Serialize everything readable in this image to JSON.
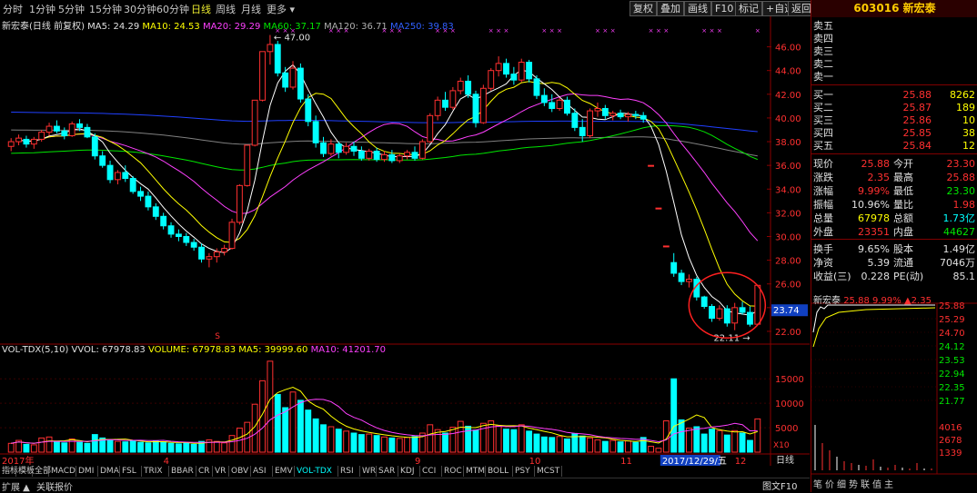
{
  "toolbar": {
    "periods": [
      "分时",
      "1分钟",
      "5分钟",
      "15分钟",
      "30分钟",
      "60分钟",
      "日线",
      "周线",
      "月线",
      "更多 ▾"
    ],
    "active_period": "日线",
    "buttons": [
      "复权",
      "叠加",
      "画线",
      "F10",
      "标记",
      "+自选",
      "返回"
    ]
  },
  "chart_title": {
    "name": "新宏泰(日线 前复权)",
    "ma5": "MA5: 24.29",
    "ma10": "MA10: 24.53",
    "ma20": "MA20: 29.29",
    "ma60": "MA60: 37.17",
    "ma120": "MA120: 36.71",
    "ma250": "MA250: 39.83"
  },
  "vol_title": {
    "name": "VOL-TDX(5,10)",
    "vvol": "VVOL: 67978.83",
    "volume": "VOLUME: 67978.83",
    "ma5": "MA5: 39999.60",
    "ma10": "MA10: 41201.70"
  },
  "annotations": {
    "high": "47.00",
    "low": "22.11",
    "current_tag": "23.74",
    "marker_s": "S",
    "x_unit": "X10"
  },
  "dates": {
    "axis_labels": [
      "2017年",
      "4",
      "9",
      "10",
      "11",
      "12"
    ],
    "cursor_date": "2017/12/29/五"
  },
  "colors": {
    "up": "#ff3030",
    "down": "#00ffff",
    "ma5": "#ffffff",
    "ma10": "#ffff00",
    "ma20": "#ff40ff",
    "ma60": "#00e600",
    "ma120": "#808080",
    "ma250": "#2040ff"
  },
  "chart_data": {
    "type": "candlestick",
    "price_axis": [
      "46.00",
      "44.00",
      "42.00",
      "40.00",
      "38.00",
      "36.00",
      "34.00",
      "32.00",
      "30.00",
      "28.00",
      "26.00",
      "24.00",
      "22.00"
    ],
    "ylim": [
      21,
      47.5
    ],
    "vol_axis": [
      "15000",
      "10000",
      "5000"
    ],
    "vol_ylim": [
      0,
      19500
    ],
    "candles": [
      [
        37.6,
        38.3,
        37.2,
        38.0
      ],
      [
        38.0,
        38.6,
        37.7,
        38.3
      ],
      [
        38.2,
        38.5,
        37.5,
        37.8
      ],
      [
        37.8,
        38.4,
        37.4,
        38.2
      ],
      [
        38.2,
        39.0,
        38.0,
        38.8
      ],
      [
        38.8,
        39.6,
        38.5,
        39.3
      ],
      [
        39.3,
        39.8,
        38.7,
        38.9
      ],
      [
        38.9,
        39.2,
        38.2,
        38.5
      ],
      [
        38.5,
        39.7,
        38.4,
        39.5
      ],
      [
        39.5,
        39.9,
        38.9,
        39.2
      ],
      [
        39.2,
        39.5,
        38.3,
        38.4
      ],
      [
        38.4,
        38.7,
        36.5,
        36.8
      ],
      [
        36.8,
        37.2,
        35.8,
        36.0
      ],
      [
        36.0,
        36.4,
        34.5,
        34.8
      ],
      [
        34.8,
        35.6,
        34.4,
        35.4
      ],
      [
        35.4,
        36.0,
        34.6,
        34.9
      ],
      [
        34.9,
        35.1,
        33.6,
        33.8
      ],
      [
        33.8,
        34.2,
        33.0,
        33.4
      ],
      [
        33.4,
        33.8,
        32.2,
        32.5
      ],
      [
        32.5,
        32.8,
        31.4,
        31.7
      ],
      [
        31.7,
        32.0,
        30.6,
        30.9
      ],
      [
        30.9,
        31.2,
        29.9,
        30.2
      ],
      [
        30.2,
        30.6,
        29.6,
        30.0
      ],
      [
        30.0,
        30.3,
        29.2,
        29.5
      ],
      [
        29.5,
        29.8,
        28.8,
        29.1
      ],
      [
        29.1,
        29.4,
        27.8,
        28.1
      ],
      [
        28.1,
        28.6,
        27.4,
        28.3
      ],
      [
        28.3,
        29.0,
        27.8,
        28.7
      ],
      [
        28.7,
        29.3,
        28.4,
        29.0
      ],
      [
        29.0,
        31.5,
        28.9,
        31.2
      ],
      [
        31.2,
        34.4,
        31.0,
        34.3
      ],
      [
        34.3,
        37.7,
        34.2,
        37.7
      ],
      [
        37.7,
        41.5,
        37.6,
        41.5
      ],
      [
        41.5,
        45.6,
        41.4,
        45.6
      ],
      [
        45.6,
        47.0,
        44.5,
        46.2
      ],
      [
        46.2,
        46.5,
        43.5,
        43.8
      ],
      [
        43.8,
        44.3,
        42.2,
        42.6
      ],
      [
        42.6,
        44.8,
        42.4,
        44.2
      ],
      [
        44.2,
        44.6,
        41.3,
        41.6
      ],
      [
        41.6,
        42.0,
        39.3,
        39.7
      ],
      [
        39.7,
        40.2,
        37.5,
        37.9
      ],
      [
        37.9,
        38.4,
        36.7,
        37.0
      ],
      [
        37.0,
        38.2,
        36.8,
        37.8
      ],
      [
        37.8,
        38.0,
        36.6,
        37.1
      ],
      [
        37.1,
        37.9,
        36.9,
        37.6
      ],
      [
        37.6,
        38.0,
        36.8,
        37.2
      ],
      [
        37.2,
        37.6,
        36.4,
        36.6
      ],
      [
        36.6,
        37.4,
        36.4,
        37.2
      ],
      [
        37.2,
        37.5,
        36.3,
        36.5
      ],
      [
        36.5,
        37.2,
        36.3,
        36.9
      ],
      [
        36.9,
        37.3,
        36.2,
        36.4
      ],
      [
        36.4,
        37.0,
        36.2,
        36.8
      ],
      [
        36.8,
        37.3,
        36.5,
        37.1
      ],
      [
        37.1,
        37.6,
        36.4,
        36.6
      ],
      [
        36.6,
        38.2,
        36.5,
        38.0
      ],
      [
        38.0,
        40.4,
        37.9,
        40.2
      ],
      [
        40.2,
        41.8,
        39.8,
        41.5
      ],
      [
        41.5,
        42.2,
        40.6,
        40.9
      ],
      [
        40.9,
        42.6,
        40.7,
        42.3
      ],
      [
        42.3,
        43.4,
        42.0,
        43.1
      ],
      [
        43.1,
        43.6,
        41.7,
        42.0
      ],
      [
        42.0,
        42.3,
        39.2,
        39.6
      ],
      [
        39.6,
        42.8,
        39.5,
        42.5
      ],
      [
        42.5,
        44.2,
        42.3,
        44.0
      ],
      [
        44.0,
        45.2,
        43.5,
        44.6
      ],
      [
        44.6,
        45.0,
        43.4,
        43.7
      ],
      [
        43.7,
        44.3,
        42.8,
        43.2
      ],
      [
        43.2,
        45.0,
        43.0,
        44.7
      ],
      [
        44.7,
        44.9,
        43.0,
        43.3
      ],
      [
        43.3,
        43.6,
        41.6,
        41.9
      ],
      [
        41.9,
        42.5,
        41.0,
        41.3
      ],
      [
        41.3,
        42.0,
        40.5,
        40.8
      ],
      [
        40.8,
        41.7,
        40.6,
        41.5
      ],
      [
        41.5,
        41.8,
        40.2,
        40.4
      ],
      [
        40.4,
        40.8,
        38.9,
        39.2
      ],
      [
        39.2,
        39.9,
        38.0,
        38.5
      ],
      [
        38.5,
        40.8,
        38.3,
        40.6
      ],
      [
        40.6,
        41.3,
        40.1,
        40.8
      ],
      [
        40.8,
        41.1,
        39.9,
        40.2
      ],
      [
        40.2,
        40.6,
        39.8,
        40.4
      ],
      [
        40.4,
        40.7,
        39.9,
        40.1
      ],
      [
        40.1,
        40.5,
        39.7,
        40.3
      ],
      [
        40.3,
        40.6,
        39.9,
        40.2
      ],
      [
        40.2,
        40.5,
        39.6,
        39.9
      ],
      [
        36.0,
        36.0,
        36.0,
        36.0
      ],
      [
        32.4,
        32.4,
        32.4,
        32.4
      ],
      [
        29.2,
        29.2,
        29.2,
        29.2
      ],
      [
        27.8,
        28.6,
        26.6,
        26.9
      ],
      [
        26.9,
        27.2,
        25.9,
        26.2
      ],
      [
        26.2,
        26.8,
        25.7,
        26.4
      ],
      [
        26.4,
        26.6,
        24.6,
        24.9
      ],
      [
        24.9,
        25.0,
        23.9,
        24.1
      ],
      [
        24.1,
        24.3,
        22.8,
        23.1
      ],
      [
        23.1,
        24.2,
        22.9,
        23.9
      ],
      [
        23.9,
        24.2,
        22.4,
        22.7
      ],
      [
        22.7,
        24.4,
        22.1,
        24.0
      ],
      [
        24.0,
        24.5,
        23.4,
        23.6
      ],
      [
        23.6,
        24.1,
        22.4,
        22.6
      ],
      [
        22.6,
        25.9,
        22.5,
        25.88
      ]
    ],
    "volumes": [
      1800,
      2400,
      1600,
      1500,
      2900,
      3100,
      2200,
      1900,
      2700,
      2000,
      1800,
      3600,
      2900,
      2600,
      2200,
      2100,
      2400,
      2000,
      1900,
      2300,
      2100,
      1800,
      1700,
      1900,
      1600,
      2200,
      2500,
      2200,
      1900,
      3400,
      4900,
      6100,
      9800,
      14600,
      18600,
      11800,
      9100,
      12300,
      10600,
      8600,
      6800,
      5600,
      5200,
      4700,
      4300,
      3900,
      3600,
      3700,
      3400,
      3100,
      2900,
      2800,
      3000,
      3200,
      3900,
      5600,
      4600,
      3900,
      5100,
      6300,
      5300,
      4500,
      5900,
      6400,
      5400,
      4700,
      4600,
      5600,
      4300,
      3700,
      3100,
      3000,
      3200,
      2700,
      3800,
      3300,
      2900,
      2500,
      2200,
      2400,
      2100,
      2300,
      2000,
      3000,
      1200,
      800,
      6400,
      15000,
      6600,
      4900,
      5200,
      3700,
      4700,
      4400,
      3500,
      4400,
      3900,
      2400,
      6798
    ]
  },
  "panel": {
    "code": "603016",
    "name": "新宏泰",
    "sell": [
      {
        "label": "卖五",
        "price": "",
        "vol": ""
      },
      {
        "label": "卖四",
        "price": "",
        "vol": ""
      },
      {
        "label": "卖三",
        "price": "",
        "vol": ""
      },
      {
        "label": "卖二",
        "price": "",
        "vol": ""
      },
      {
        "label": "卖一",
        "price": "",
        "vol": ""
      }
    ],
    "buy": [
      {
        "label": "买一",
        "price": "25.88",
        "vol": "8262"
      },
      {
        "label": "买二",
        "price": "25.87",
        "vol": "189"
      },
      {
        "label": "买三",
        "price": "25.86",
        "vol": "10"
      },
      {
        "label": "买四",
        "price": "25.85",
        "vol": "38"
      },
      {
        "label": "买五",
        "price": "25.84",
        "vol": "12"
      }
    ],
    "stats": [
      {
        "l1": "现价",
        "v1": "25.88",
        "l2": "今开",
        "v2": "23.30"
      },
      {
        "l1": "涨跌",
        "v1": "2.35",
        "l2": "最高",
        "v2": "25.88"
      },
      {
        "l1": "涨幅",
        "v1": "9.99%",
        "l2": "最低",
        "v2": "23.30"
      },
      {
        "l1": "振幅",
        "v1": "10.96%",
        "l2": "量比",
        "v2": "1.98"
      },
      {
        "l1": "总量",
        "v1": "67978",
        "l2": "总额",
        "v2": "1.73亿"
      },
      {
        "l1": "外盘",
        "v1": "23351",
        "l2": "内盘",
        "v2": "44627"
      },
      {
        "l1": "换手",
        "v1": "9.65%",
        "l2": "股本",
        "v2": "1.49亿"
      },
      {
        "l1": "净资",
        "v1": "5.39",
        "l2": "流通",
        "v2": "7046万"
      },
      {
        "l1": "收益(三)",
        "v1": "0.228",
        "l2": "PE(动)",
        "v2": "85.1"
      }
    ],
    "mini_title": "新宏泰",
    "mini_price": "25.88",
    "mini_pct": "9.99%",
    "mini_chg": "▲2.35",
    "mini_axis": [
      "25.88",
      "25.29",
      "24.70",
      "24.12",
      "23.53",
      "22.94",
      "22.35",
      "21.77"
    ],
    "mini_vol_axis": [
      "4016",
      "2678",
      "1339"
    ],
    "mini_tabs": [
      "笔",
      "价",
      "细",
      "势",
      "联",
      "值",
      "主"
    ]
  },
  "bottom_tabs": [
    "指标",
    "模板",
    "全部",
    "MACD",
    "DMI",
    "DMA",
    "FSL",
    "TRIX",
    "BBAR",
    "CR",
    "VR",
    "OBV",
    "ASI",
    "EMV",
    "VOL-TDX",
    "RSI",
    "WR",
    "SAR",
    "KDJ",
    "CCI",
    "ROC",
    "MTM",
    "BOLL",
    "PSY",
    "MCST"
  ],
  "active_tab": "VOL-TDX",
  "footer": {
    "left1": "扩展 ▲",
    "left2": "关联报价",
    "right1": "日线",
    "right2": "图文F10"
  }
}
